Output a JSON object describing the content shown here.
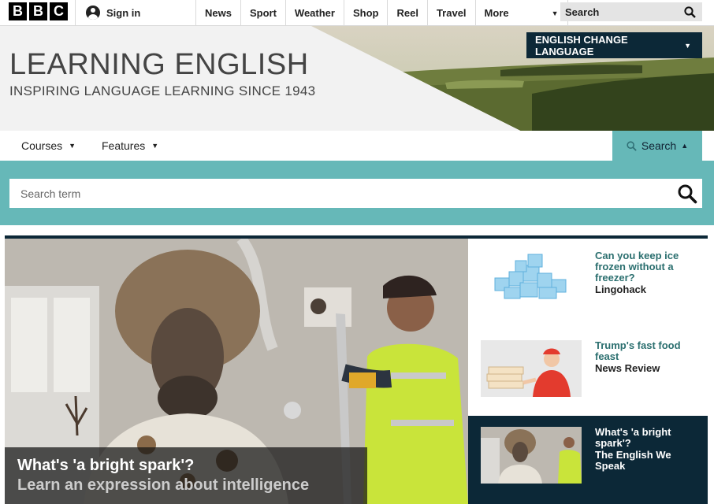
{
  "topbar": {
    "logo": [
      "B",
      "B",
      "C"
    ],
    "signin_label": "Sign in",
    "nav": [
      "News",
      "Sport",
      "Weather",
      "Shop",
      "Reel",
      "Travel"
    ],
    "more_label": "More",
    "search_label": "Search"
  },
  "banner": {
    "title": "LEARNING ENGLISH",
    "subtitle": "INSPIRING LANGUAGE LEARNING SINCE 1943",
    "language_button": "ENGLISH CHANGE LANGUAGE"
  },
  "subnav": {
    "courses": "Courses",
    "features": "Features",
    "search_tab": "Search"
  },
  "searchbar": {
    "placeholder": "Search term"
  },
  "hero": {
    "title": "What's 'a bright spark'?",
    "subtitle": "Learn an expression about intelligence"
  },
  "cards": [
    {
      "title": "Can you keep ice frozen without a freezer?",
      "series": "Lingohack"
    },
    {
      "title": "Trump's fast food feast",
      "series": "News Review"
    },
    {
      "title": "What's 'a bright spark'?",
      "series": "The English We Speak"
    }
  ],
  "colors": {
    "dark_navy": "#0c2837",
    "teal": "#66b8b8",
    "card_title": "#2b6f6f"
  }
}
